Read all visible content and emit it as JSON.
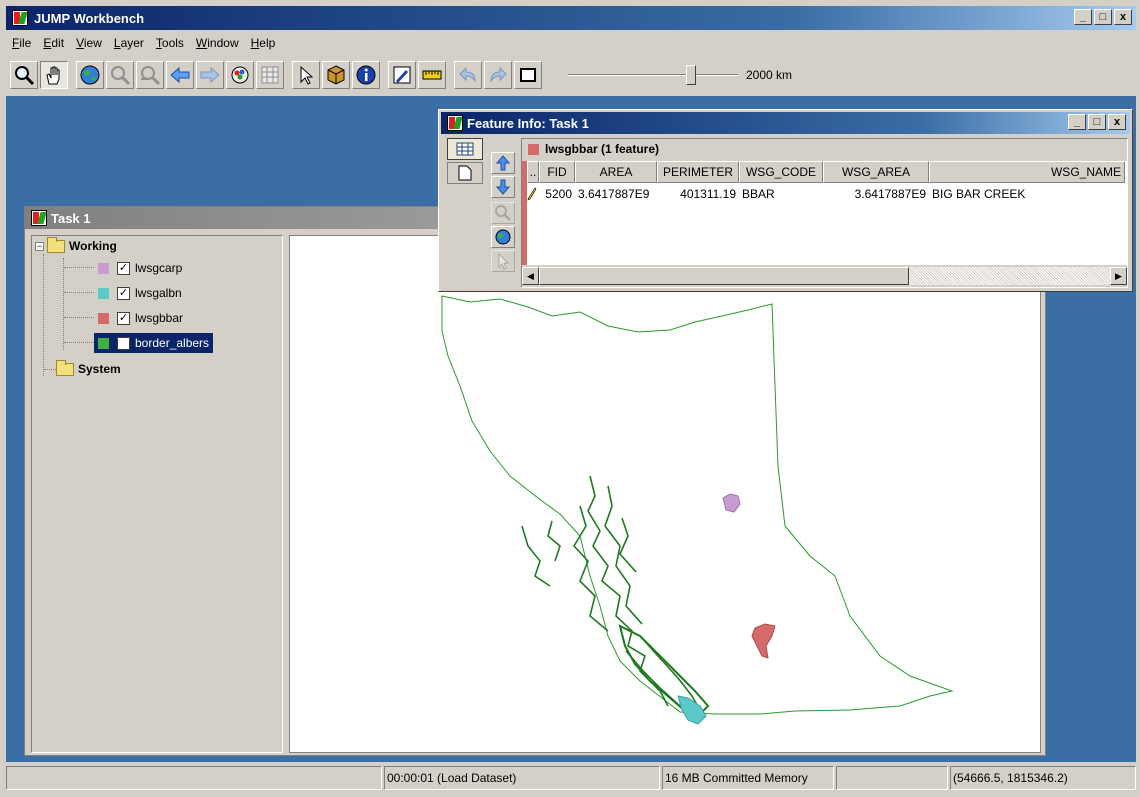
{
  "app": {
    "title": "JUMP Workbench"
  },
  "window_buttons": [
    "_",
    "□",
    "x"
  ],
  "menu": [
    {
      "label": "File",
      "key": "F",
      "rest": "ile"
    },
    {
      "label": "Edit",
      "key": "E",
      "rest": "dit"
    },
    {
      "label": "View",
      "key": "V",
      "rest": "iew"
    },
    {
      "label": "Layer",
      "key": "L",
      "rest": "ayer"
    },
    {
      "label": "Tools",
      "key": "T",
      "rest": "ools"
    },
    {
      "label": "Window",
      "key": "W",
      "rest": "indow"
    },
    {
      "label": "Help",
      "key": "H",
      "rest": "elp"
    }
  ],
  "toolbar": {
    "tools": [
      "zoom-tool-icon",
      "pan-tool-icon",
      "zoom-to-full-extent-icon",
      "zoom-to-selected-icon",
      "zoom-previous-icon",
      "zoom-back-icon",
      "zoom-forward-icon",
      "layer-view-icon",
      "attribute-table-icon",
      "select-features-icon",
      "select-layer-icon",
      "feature-info-icon",
      "edit-toolbox-icon",
      "measure-icon",
      "undo-icon",
      "redo-icon",
      "fence-icon"
    ],
    "scale_label": "2000 km",
    "scale_fraction": 0.74
  },
  "task_window": {
    "title": "Task 1",
    "tree": {
      "working_label": "Working",
      "layers": [
        {
          "name": "lwsgcarp",
          "color": "#c89bd2",
          "checked": "✓"
        },
        {
          "name": "lwsgalbn",
          "color": "#5cc8c8",
          "checked": "✓"
        },
        {
          "name": "lwsgbbar",
          "color": "#d46a6a",
          "checked": "✓"
        },
        {
          "name": "border_albers",
          "color": "#40b040",
          "checked": "✓"
        }
      ],
      "system_label": "System"
    }
  },
  "feature_info": {
    "title": "Feature Info: Task 1",
    "layer_header": "lwsgbbar (1 feature)",
    "layer_color": "#d46a6a",
    "columns": [
      "..",
      "FID",
      "AREA",
      "PERIMETER",
      "WSG_CODE",
      "WSG_AREA",
      "WSG_NAME"
    ],
    "row": {
      "FID": "5200",
      "AREA": "3.6417887E9",
      "PERIMETER": "401311.19",
      "WSG_CODE": "BBAR",
      "WSG_AREA": "3.6417887E9",
      "WSG_NAME": "BIG BAR CREEK"
    },
    "scroll_left": "◀",
    "scroll_right": "▶"
  },
  "status": {
    "cells": [
      "",
      "00:00:01 (Load Dataset)",
      "16 MB Committed Memory",
      "",
      "(54666.5, 1815346.2)"
    ]
  },
  "colors": {
    "title_bar": "#0a246a",
    "desktop": "#3a6ea5",
    "border_line": "#2a9a2a",
    "coast_fill": "#207820"
  }
}
